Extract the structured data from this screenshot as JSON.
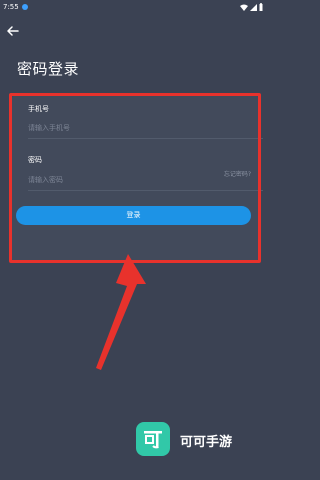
{
  "status_bar": {
    "time": "7:55"
  },
  "header": {
    "title": "密码登录"
  },
  "form": {
    "phone_label": "手机号",
    "phone_placeholder": "请输入手机号",
    "password_label": "密码",
    "password_placeholder": "请输入密码",
    "forgot_password": "忘记密码?",
    "login_button": "登录"
  },
  "watermark": {
    "brand_name": "可可手游"
  },
  "colors": {
    "background": "#3b4253",
    "accent": "#1d93e6",
    "highlight": "#e8322c",
    "logo": "#31c8a8"
  }
}
